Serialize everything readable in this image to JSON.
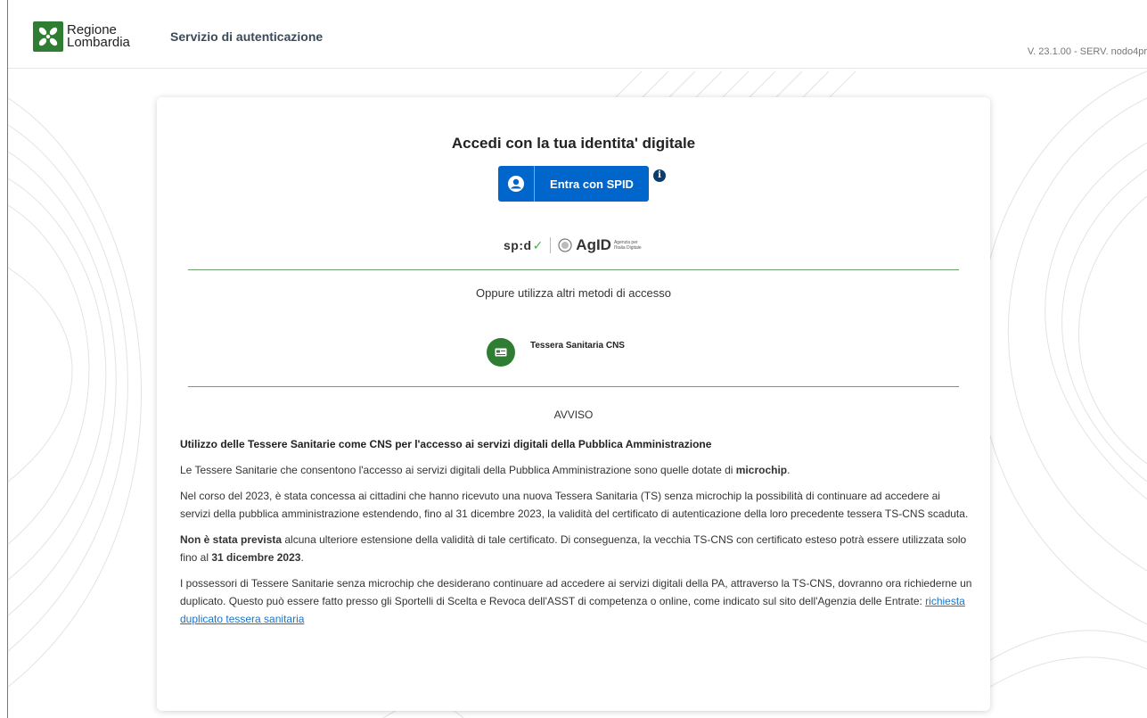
{
  "header": {
    "logo_line1": "Regione",
    "logo_line2": "Lombardia",
    "service_title": "Servizio di autenticazione",
    "version": "V. 23.1.00 - SERV. nodo4pr"
  },
  "login": {
    "title": "Accedi con la tua identita' digitale",
    "spid_button_label": "Entra con SPID",
    "spid_word": "sp:d",
    "agid_word": "AgID",
    "agid_small": "Agenzia per l'Italia Digitale",
    "alt_methods": "Oppure utilizza altri metodi di accesso",
    "cns_label": "Tessera Sanitaria CNS"
  },
  "avviso": {
    "title": "AVVISO",
    "heading": "Utilizzo delle Tessere Sanitarie come CNS per l'accesso ai servizi digitali della Pubblica Amministrazione",
    "p1_a": "Le Tessere Sanitarie che consentono l'accesso ai servizi digitali della Pubblica Amministrazione sono quelle dotate di ",
    "p1_b": "microchip",
    "p1_c": ".",
    "p2": "Nel corso del 2023, è stata concessa ai cittadini che hanno ricevuto una nuova Tessera Sanitaria (TS) senza microchip la possibilità di continuare ad accedere ai servizi della pubblica amministrazione estendendo, fino al 31 dicembre 2023, la validità del certificato di autenticazione della loro precedente tessera TS-CNS scaduta.",
    "p3_a": "Non è stata prevista",
    "p3_b": " alcuna ulteriore estensione della validità di tale certificato. Di conseguenza, la vecchia TS-CNS con certificato esteso potrà essere utilizzata solo fino al ",
    "p3_c": "31 dicembre 2023",
    "p3_d": ".",
    "p4": "I possessori di Tessere Sanitarie senza microchip che desiderano continuare ad accedere ai servizi digitali della PA, attraverso la TS-CNS, dovranno ora richiederne un duplicato. Questo può essere fatto presso gli Sportelli di Scelta e Revoca dell'ASST di competenza o online, come indicato sul sito dell'Agenzia delle Entrate: ",
    "p4_link": "richiesta duplicato tessera sanitaria"
  },
  "colors": {
    "spid_blue": "#0066cc",
    "brand_green": "#2e7d32",
    "divider_green": "#6aa16c",
    "link_blue": "#1a73c8"
  },
  "icons": [
    "regione-lombardia-logo",
    "user-icon",
    "info-icon",
    "spid-logo",
    "agid-seal-icon",
    "health-card-icon"
  ]
}
